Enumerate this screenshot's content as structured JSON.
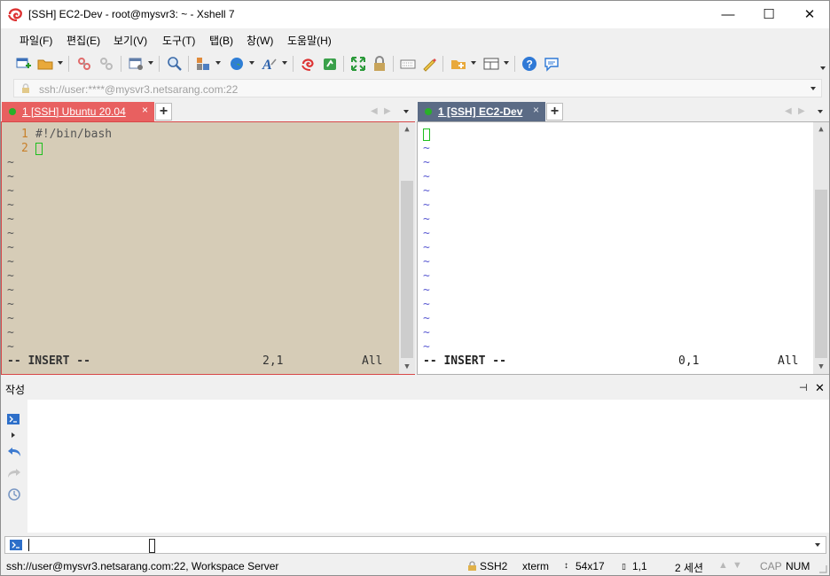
{
  "window": {
    "title": "[SSH] EC2-Dev - root@mysvr3: ~ - Xshell 7",
    "minimize": "—",
    "maximize": "☐",
    "close": "✕"
  },
  "menu": [
    "파일(F)",
    "편집(E)",
    "보기(V)",
    "도구(T)",
    "탭(B)",
    "창(W)",
    "도움말(H)"
  ],
  "address": {
    "value": "ssh://user:****@mysvr3.netsarang.com:22"
  },
  "left_pane": {
    "tab_label": "1 [SSH] Ubuntu 20.04",
    "tab_close": "×",
    "lines": [
      {
        "num": "1",
        "text": "#!/bin/bash"
      },
      {
        "num": "2",
        "text": ""
      }
    ],
    "tilde": "~",
    "mode": "-- INSERT --",
    "position": "2,1",
    "scroll": "All",
    "bg_color": "#d6ccb7",
    "tab_color": "#e86060"
  },
  "right_pane": {
    "tab_label": "1 [SSH] EC2-Dev",
    "tab_close": "×",
    "tilde": "~",
    "mode": "-- INSERT --",
    "position": "0,1",
    "scroll": "All",
    "tab_color": "#5b6b85"
  },
  "compose": {
    "title": "작성",
    "pin": "⊣",
    "close": "✕"
  },
  "status": {
    "connection": "ssh://user@mysvr3.netsarang.com:22, Workspace Server",
    "protocol": "SSH2",
    "term": "xterm",
    "size": "54x17",
    "cursor": "1,1",
    "sessions": "2 세션",
    "cap": "CAP",
    "num": "NUM"
  }
}
